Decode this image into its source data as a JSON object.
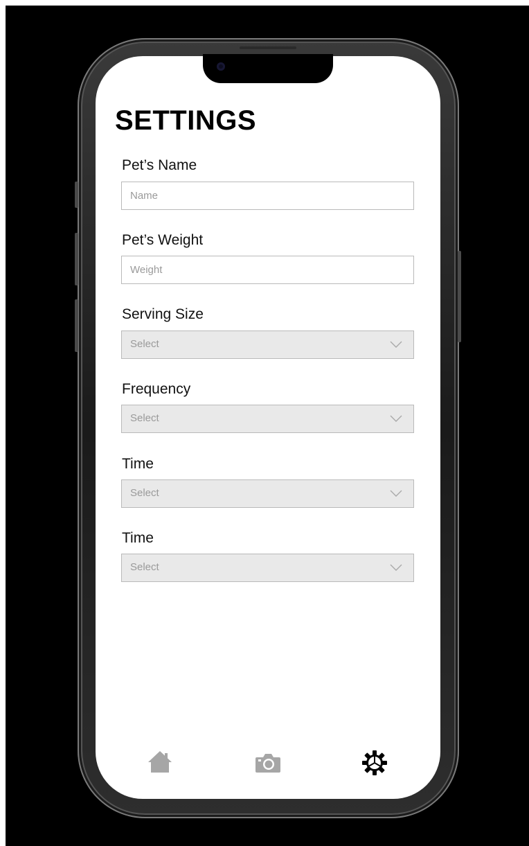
{
  "header": {
    "title": "SETTINGS"
  },
  "form": {
    "pet_name": {
      "label": "Pet’s Name",
      "placeholder": "Name"
    },
    "pet_weight": {
      "label": "Pet’s Weight",
      "placeholder": "Weight"
    },
    "serving_size": {
      "label": "Serving Size",
      "value": "Select"
    },
    "frequency": {
      "label": "Frequency",
      "value": "Select"
    },
    "time_1": {
      "label": "Time",
      "value": "Select"
    },
    "time_2": {
      "label": "Time",
      "value": "Select"
    }
  },
  "icons": {
    "home": "home-icon",
    "camera": "camera-icon",
    "settings": "gear-icon",
    "dropdown": "chevron-down-icon"
  },
  "colors": {
    "inactive_icon": "#a6a6a6",
    "active_icon": "#000000",
    "select_background": "#e9e9e9",
    "input_border": "#b9b9b9",
    "placeholder": "#9a9a9a"
  }
}
